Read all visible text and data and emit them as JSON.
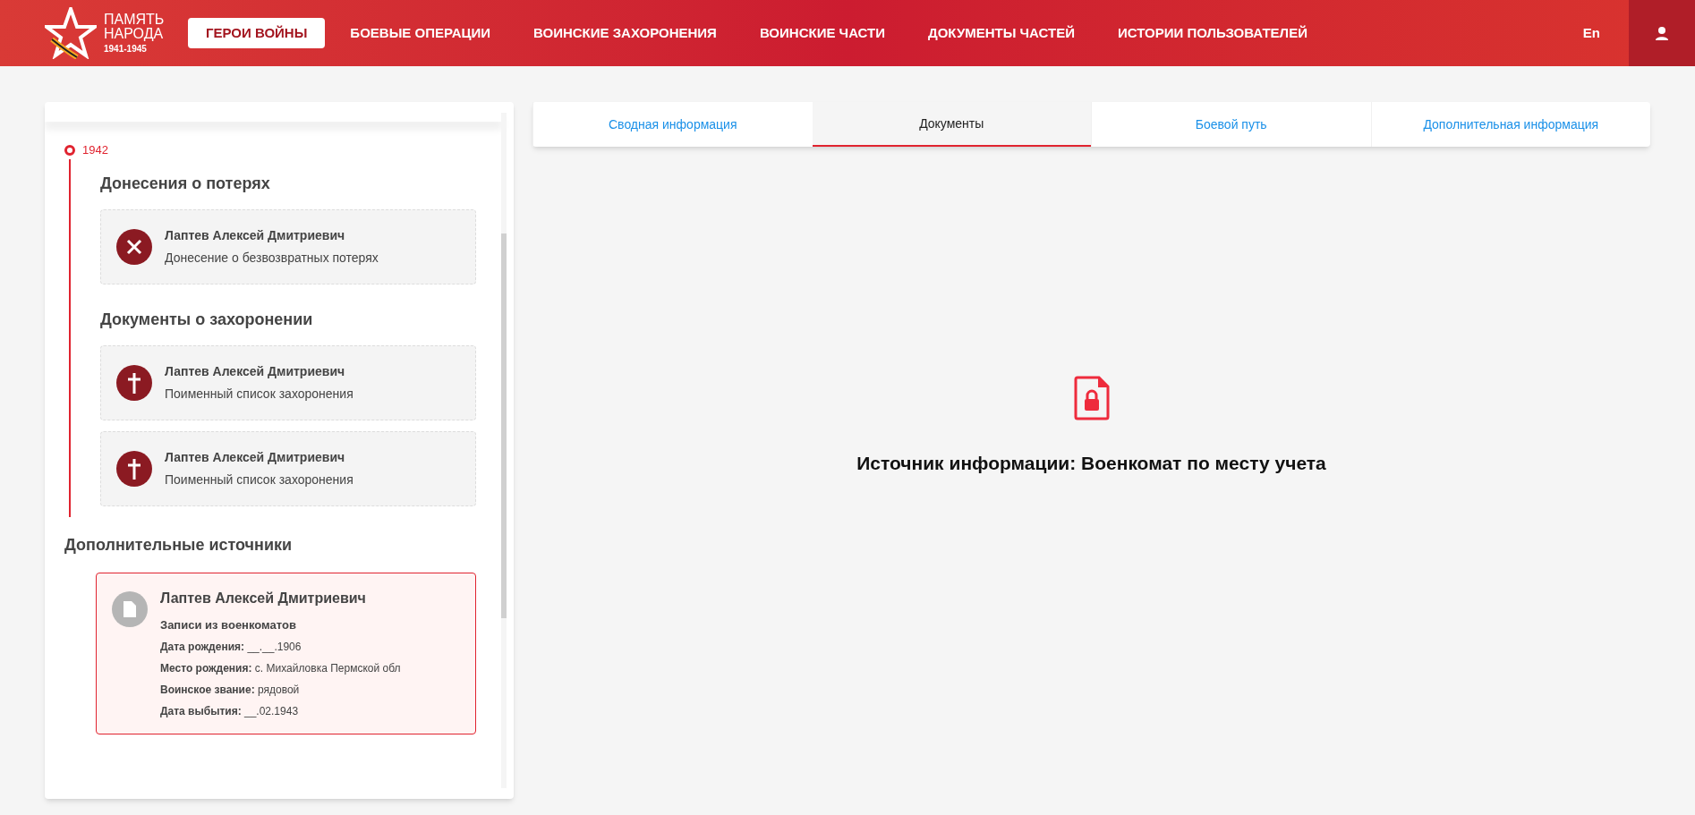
{
  "header": {
    "logo": {
      "line1": "ПАМЯТЬ",
      "line2": "НАРОДА",
      "years": "1941-1945"
    },
    "nav": [
      {
        "label": "ГЕРОИ ВОЙНЫ",
        "selected": true
      },
      {
        "label": "БОЕВЫЕ ОПЕРАЦИИ",
        "selected": false
      },
      {
        "label": "ВОИНСКИЕ ЗАХОРОНЕНИЯ",
        "selected": false
      },
      {
        "label": "ВОИНСКИЕ ЧАСТИ",
        "selected": false
      },
      {
        "label": "ДОКУМЕНТЫ ЧАСТЕЙ",
        "selected": false
      },
      {
        "label": "ИСТОРИИ ПОЛЬЗОВАТЕЛЕЙ",
        "selected": false
      }
    ],
    "language": "En"
  },
  "timeline": {
    "year": "1942",
    "sections": [
      {
        "title": "Донесения о потерях",
        "documents": [
          {
            "kind": "loss",
            "name": "Лаптев Алексей Дмитриевич",
            "type": "Донесение о безвозвратных потерях"
          }
        ]
      },
      {
        "title": "Документы о захоронении",
        "documents": [
          {
            "kind": "burial",
            "name": "Лаптев Алексей Дмитриевич",
            "type": "Поименный список захоронения"
          },
          {
            "kind": "burial",
            "name": "Лаптев Алексей Дмитриевич",
            "type": "Поименный список захоронения"
          }
        ]
      }
    ]
  },
  "additional_sources": {
    "title": "Дополнительные источники",
    "record": {
      "name": "Лаптев Алексей Дмитриевич",
      "type": "Записи из военкоматов",
      "fields": [
        {
          "label": "Дата рождения:",
          "value": "__.__.1906"
        },
        {
          "label": "Место рождения:",
          "value": "с. Михайловка Пермской обл"
        },
        {
          "label": "Воинское звание:",
          "value": "рядовой"
        },
        {
          "label": "Дата выбытия:",
          "value": "__.02.1943"
        }
      ]
    }
  },
  "tabs": [
    {
      "label": "Сводная информация",
      "selected": false
    },
    {
      "label": "Документы",
      "selected": true
    },
    {
      "label": "Боевой путь",
      "selected": false
    },
    {
      "label": "Дополнительная информация",
      "selected": false
    }
  ],
  "message": "Источник информации: Военкомат по месту учета"
}
